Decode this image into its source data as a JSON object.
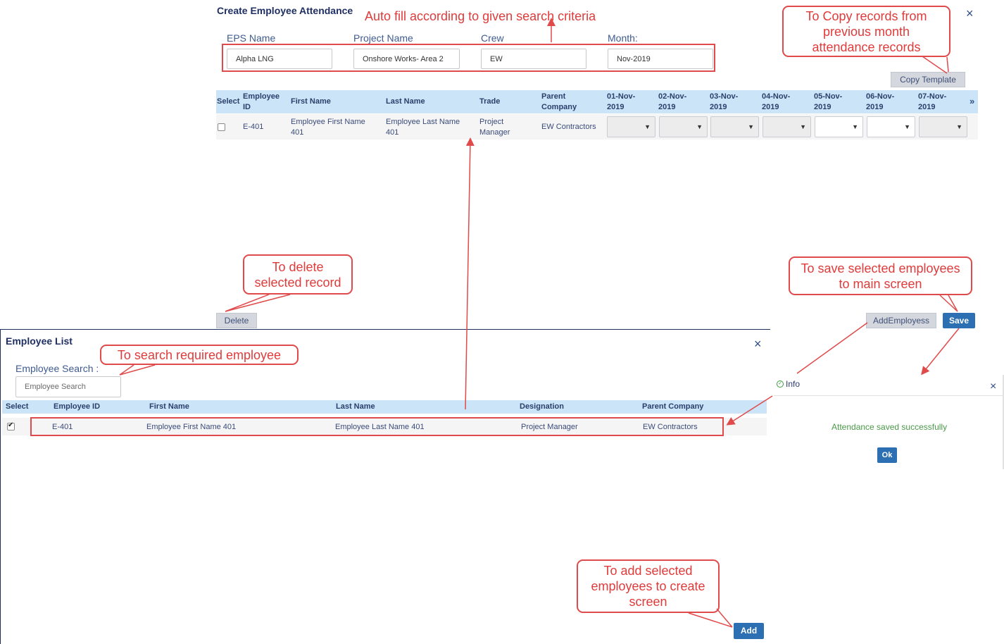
{
  "create_dialog": {
    "title": "Create Employee Attendance",
    "close_glyph": "×",
    "fields": [
      {
        "label": "EPS Name",
        "value": "Alpha LNG"
      },
      {
        "label": "Project Name",
        "value": "Onshore  Works- Area 2"
      },
      {
        "label": "Crew",
        "value": "EW"
      },
      {
        "label": "Month:",
        "value": "Nov-2019"
      }
    ],
    "copy_template_label": "Copy Template",
    "columns": [
      "Select",
      "Employee ID",
      "First Name",
      "Last Name",
      "Trade",
      "Parent Company",
      "01-Nov-2019",
      "02-Nov-2019",
      "03-Nov-2019",
      "04-Nov-2019",
      "05-Nov-2019",
      "06-Nov-2019",
      "07-Nov-2019"
    ],
    "next_glyph": "»",
    "row": {
      "employee_id": "E-401",
      "first_name": "Employee First Name 401",
      "last_name": "Employee Last Name 401",
      "trade": "Project Manager",
      "parent_company": "EW Contractors",
      "caret": "▼"
    },
    "delete_label": "Delete",
    "add_employees_label": "AddEmployess",
    "save_label": "Save"
  },
  "employee_list": {
    "title": "Employee List",
    "close_glyph": "×",
    "search_label": "Employee Search :",
    "search_placeholder": "Employee Search",
    "columns": [
      "Select",
      "Employee ID",
      "First Name",
      "Last Name",
      "Designation",
      "Parent Company"
    ],
    "row": {
      "employee_id": "E-401",
      "first_name": "Employee First Name 401",
      "last_name": "Employee Last Name 401",
      "designation": "Project Manager",
      "parent_company": "EW Contractors",
      "selected": true
    },
    "add_label": "Add"
  },
  "info_dialog": {
    "title": "Info",
    "close_glyph": "×",
    "message": "Attendance saved successfully",
    "ok_label": "Ok"
  },
  "annotations": {
    "auto_fill": "Auto fill according to given search criteria",
    "copy_records": "To Copy records from\nprevious month\nattendance records",
    "delete_record": "To delete\nselected record",
    "save_selected": "To save selected employees\nto main screen",
    "search_employee": "To search required employee",
    "add_selected": "To add selected\nemployees to create\nscreen"
  },
  "colors": {
    "header_row": "#cbe4f8",
    "primary_button": "#2c6fb2",
    "annotation_red": "#e03b3b",
    "success_text": "#4a9a48"
  }
}
